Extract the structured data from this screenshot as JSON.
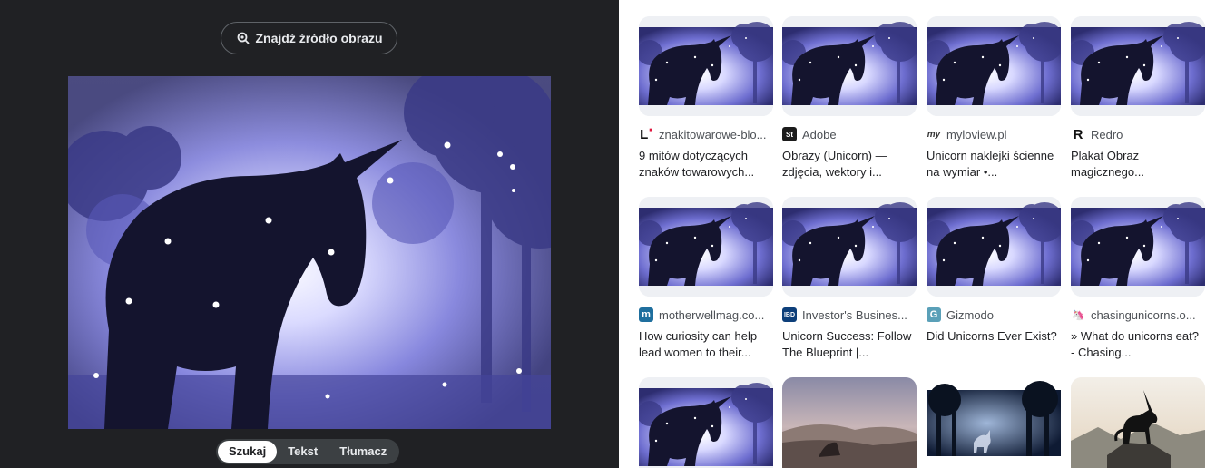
{
  "left_panel": {
    "find_source_label": "Znajdź źródło obrazu",
    "modes": [
      {
        "label": "Szukaj",
        "active": true
      },
      {
        "label": "Tekst",
        "active": false
      },
      {
        "label": "Tłumacz",
        "active": false
      }
    ]
  },
  "results": [
    {
      "source": "znakitowarowe-blo...",
      "title": "9 mitów dotyczących znaków towarowych...",
      "favicon": "L",
      "favicon_color": "#111111",
      "image": "unicorn-silhouette"
    },
    {
      "source": "Adobe",
      "title": "Obrazy (Unicorn) — zdjęcia, wektory i...",
      "favicon": "St",
      "favicon_color": "#1b1b1b",
      "image": "unicorn-silhouette"
    },
    {
      "source": "myloview.pl",
      "title": "Unicorn naklejki ścienne na wymiar •...",
      "favicon": "my",
      "favicon_color": "#333333",
      "image": "unicorn-silhouette"
    },
    {
      "source": "Redro",
      "title": "Plakat Obraz magicznego...",
      "favicon": "R",
      "favicon_color": "#111111",
      "image": "unicorn-silhouette"
    },
    {
      "source": "motherwellmag.co...",
      "title": "How curiosity can help lead women to their...",
      "favicon": "m",
      "favicon_color": "#1f6f9e",
      "image": "unicorn-silhouette"
    },
    {
      "source": "Investor's Busines...",
      "title": "Unicorn Success: Follow The Blueprint |...",
      "favicon": "IBD",
      "favicon_color": "#0d3f7a",
      "image": "unicorn-silhouette"
    },
    {
      "source": "Gizmodo",
      "title": "Did Unicorns Ever Exist?",
      "favicon": "G",
      "favicon_color": "#5aa0b8",
      "image": "unicorn-silhouette"
    },
    {
      "source": "chasingunicorns.o...",
      "title": "» What do unicorns eat? - Chasing...",
      "favicon": "🦄",
      "favicon_color": "#f2c6d8",
      "image": "unicorn-silhouette"
    },
    {
      "source": "",
      "title": "",
      "favicon": "",
      "favicon_color": "",
      "image": "unicorn-silhouette"
    },
    {
      "source": "",
      "title": "",
      "favicon": "",
      "favicon_color": "",
      "image": "unicorn-dusk-landscape"
    },
    {
      "source": "",
      "title": "",
      "favicon": "",
      "favicon_color": "",
      "image": "unicorn-forest-night"
    },
    {
      "source": "",
      "title": "",
      "favicon": "",
      "favicon_color": "",
      "image": "unicorn-on-rock"
    }
  ]
}
